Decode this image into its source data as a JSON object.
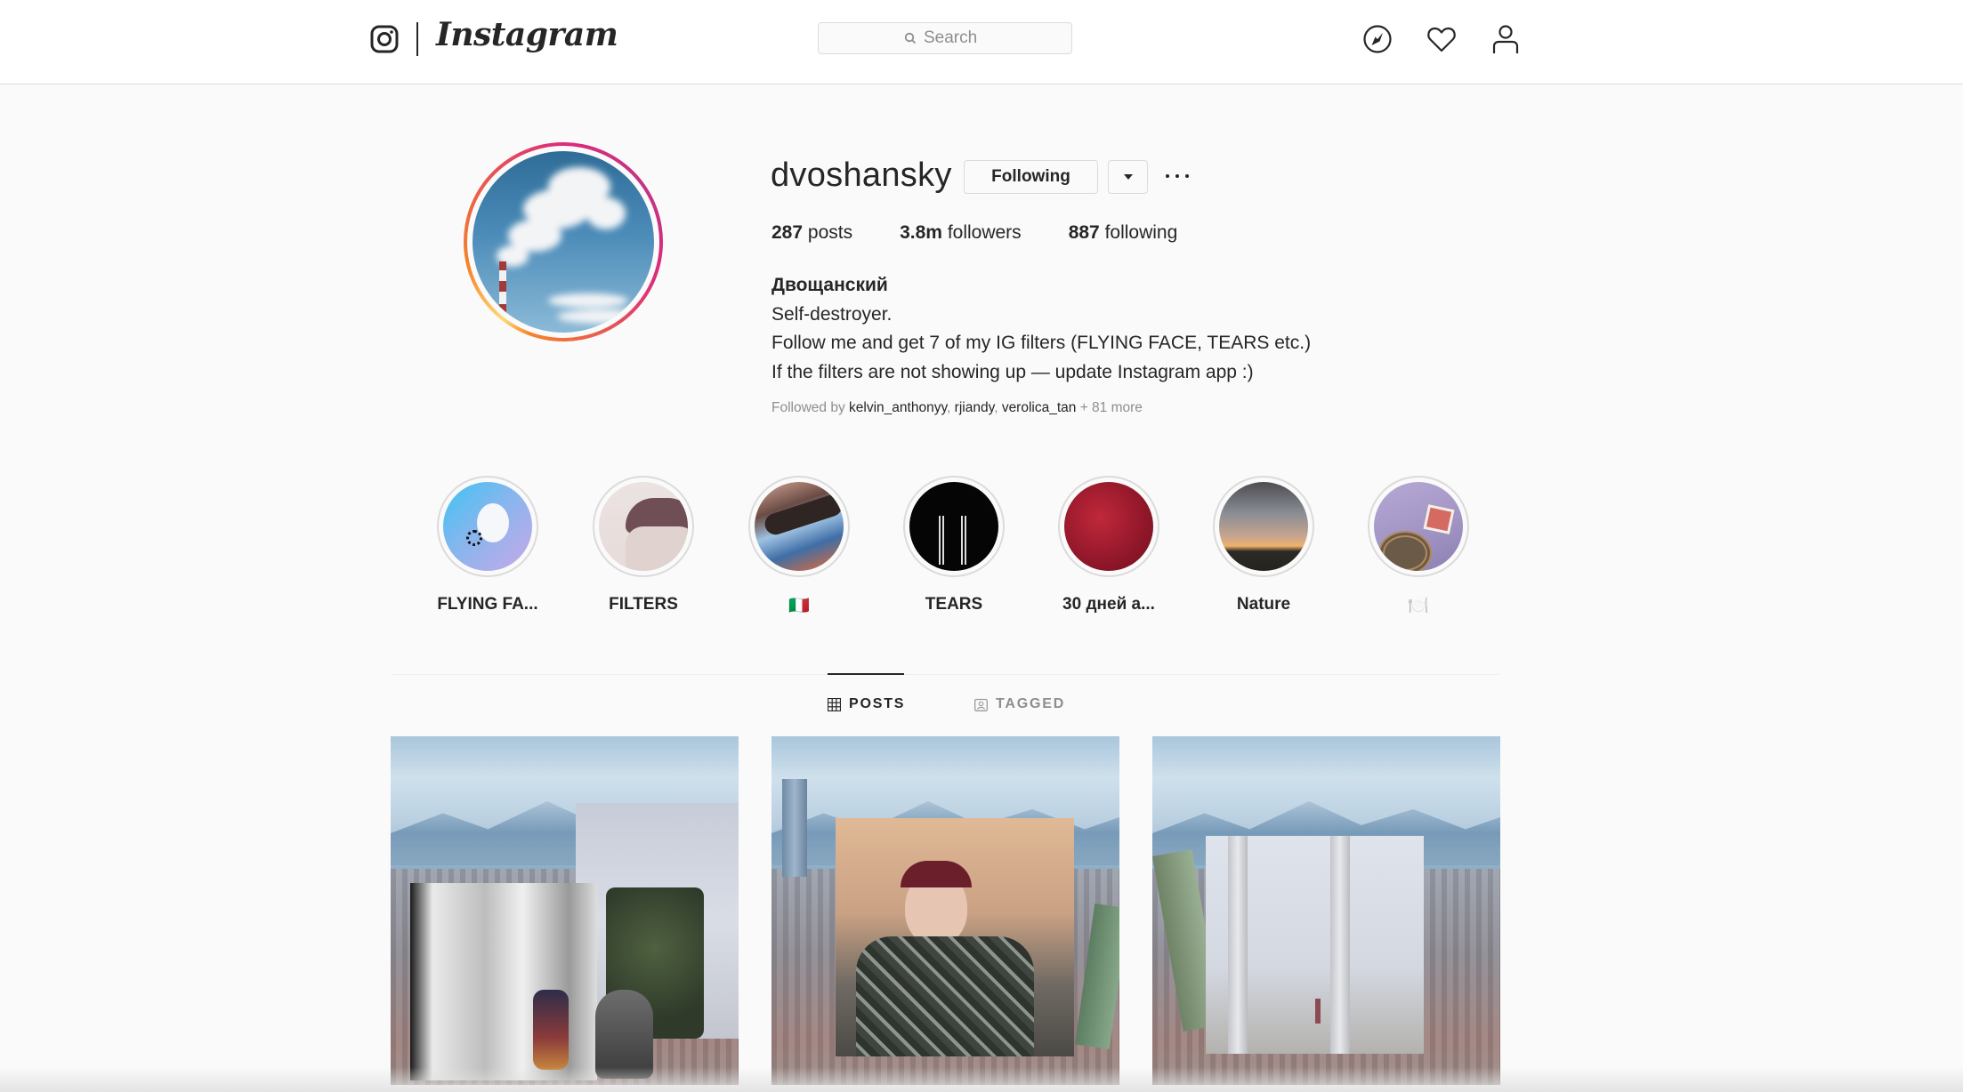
{
  "topnav": {
    "brand": "Instagram",
    "search": {
      "placeholder": "Search",
      "value": ""
    },
    "icons": [
      "compass-icon",
      "heart-icon",
      "user-icon"
    ]
  },
  "profile": {
    "username": "dvoshansky",
    "following_button": "Following",
    "stats": {
      "posts": {
        "count": "287",
        "label": "posts"
      },
      "followers": {
        "count": "3.8m",
        "label": "followers"
      },
      "following": {
        "count": "887",
        "label": "following"
      }
    },
    "bio": {
      "full_name": "Двощанский",
      "lines": [
        "Self-destroyer.",
        "Follow me and get 7 of my IG filters (FLYING FACE, TEARS etc.)",
        "If the filters are not showing up — update Instagram app :)"
      ]
    },
    "followed_by": {
      "prefix": "Followed by",
      "users": [
        "kelvin_anthonyy",
        "rjiandy",
        "verolica_tan"
      ],
      "more": "+ 81 more"
    }
  },
  "highlights": [
    {
      "label": "FLYING FA..."
    },
    {
      "label": "FILTERS"
    },
    {
      "label": "🇮🇹"
    },
    {
      "label": "TEARS"
    },
    {
      "label": "30 дней а..."
    },
    {
      "label": "Nature"
    },
    {
      "label": "🍽️"
    }
  ],
  "tabs": [
    {
      "label": "POSTS",
      "active": true
    },
    {
      "label": "TAGGED",
      "active": false
    }
  ],
  "colors": {
    "text": "#262626",
    "muted": "#8e8e8e",
    "border": "#dbdbdb",
    "background": "#fafafa",
    "story_ring_start": "#f58529",
    "story_ring_end": "#c13584"
  }
}
